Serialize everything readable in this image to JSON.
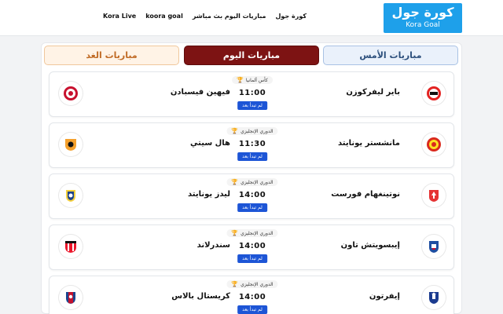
{
  "brand": {
    "name_ar": "كورة جول",
    "name_en": "Kora Goal"
  },
  "nav": [
    {
      "label": "كورة جول"
    },
    {
      "label": "مباريات اليوم بث مباشر"
    },
    {
      "label": "koora goal"
    },
    {
      "label": "Kora Live"
    }
  ],
  "tabs": {
    "yesterday": "مباريات الأمس",
    "today": "مباريات اليوم",
    "tomorrow": "مباريات الغد",
    "active": "today"
  },
  "matches": [
    {
      "home": "باير ليفركوزن",
      "away": "فيهين فيسبادن",
      "competition": "كأس ألمانيا",
      "time": "11:00",
      "status": "لم تبدأ بعد",
      "home_crest": "bayer-leverkusen-crest",
      "away_crest": "wehen-wiesbaden-crest"
    },
    {
      "home": "مانشستر يونايتد",
      "away": "هال سيتي",
      "competition": "الدوري الإنجليزي",
      "time": "11:30",
      "status": "لم تبدأ بعد",
      "home_crest": "man-united-crest",
      "away_crest": "hull-city-crest"
    },
    {
      "home": "نوتينغهام فورست",
      "away": "ليدز يونايتد",
      "competition": "الدوري الإنجليزي",
      "time": "14:00",
      "status": "لم تبدأ بعد",
      "home_crest": "nottingham-forest-crest",
      "away_crest": "leeds-united-crest"
    },
    {
      "home": "إيبسويتش تاون",
      "away": "سندرلاند",
      "competition": "الدوري الإنجليزي",
      "time": "14:00",
      "status": "لم تبدأ بعد",
      "home_crest": "ipswich-town-crest",
      "away_crest": "sunderland-crest"
    },
    {
      "home": "إيفرتون",
      "away": "كريستال بالاس",
      "competition": "الدوري الإنجليزي",
      "time": "14:00",
      "status": "لم تبدأ بعد",
      "home_crest": "everton-crest",
      "away_crest": "crystal-palace-crest"
    }
  ],
  "colors": {
    "brand": "#1ea0ea",
    "today_tab": "#7d1313",
    "status_badge": "#1d55d6"
  }
}
